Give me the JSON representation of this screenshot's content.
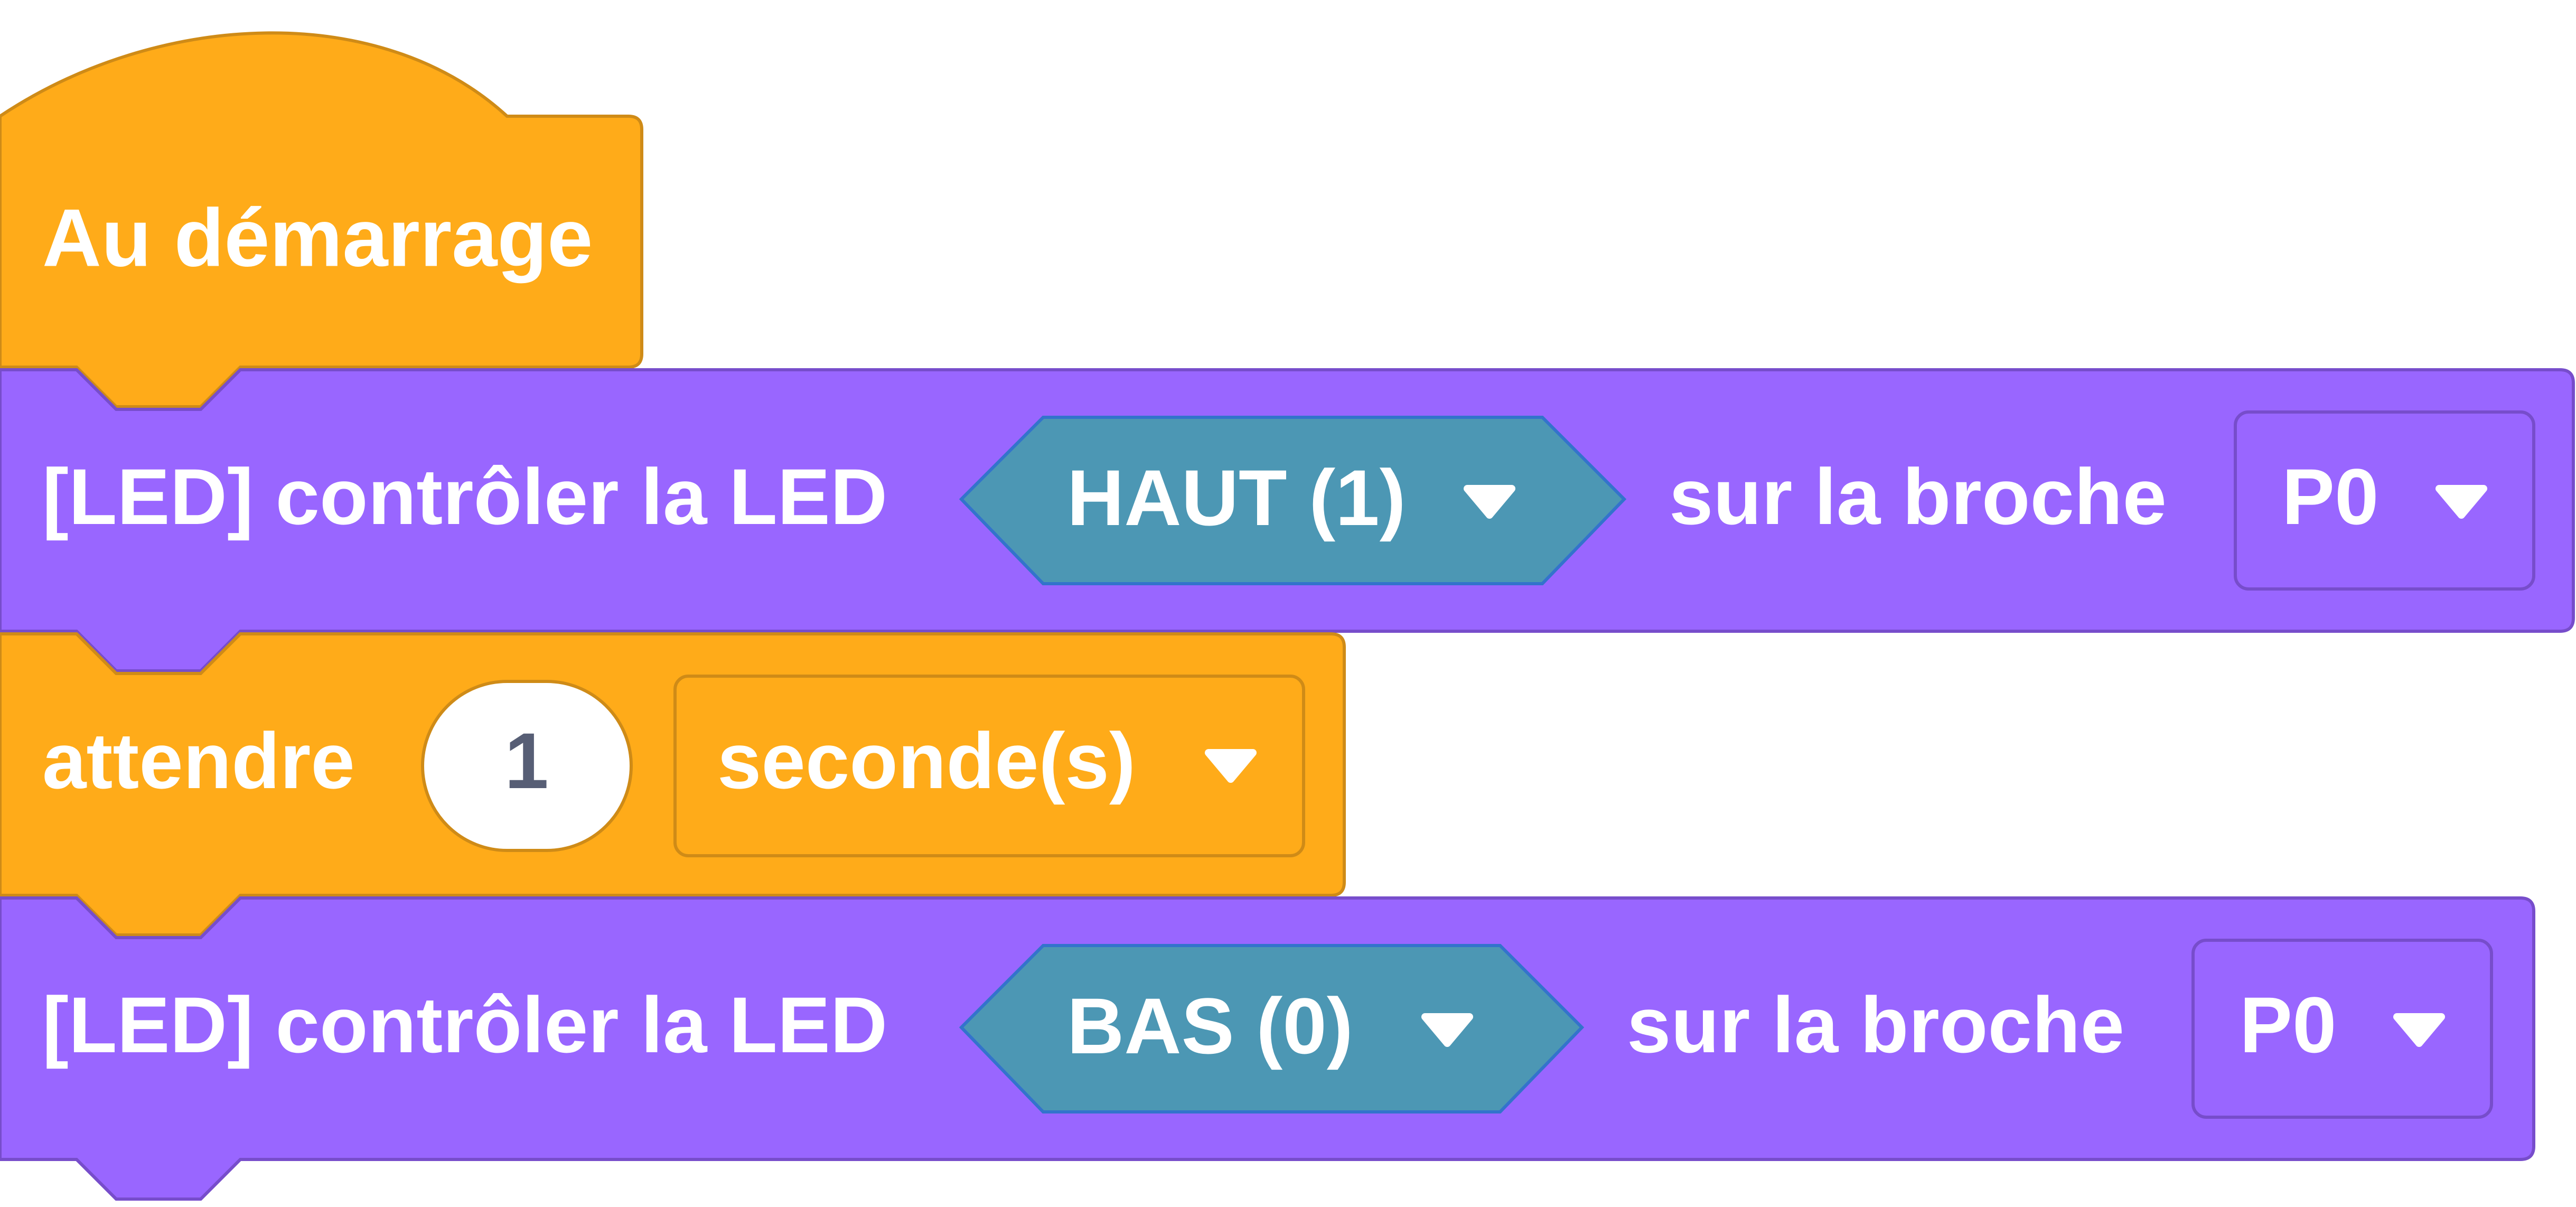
{
  "colors": {
    "events": "#FFAB19",
    "events_stroke": "#CF8B17",
    "led": "#9966FF",
    "led_stroke": "#774DCB",
    "menu": "#4C97B4",
    "menu_stroke": "#3373CC",
    "number_text": "#575E75",
    "white": "#FFFFFF"
  },
  "hat": {
    "label": "Au démarrage"
  },
  "blocks": [
    {
      "label": "[LED] contrôler la LED",
      "state": "HAUT (1)",
      "pin_label": "sur la broche",
      "pin": "P0"
    },
    {
      "label": "attendre",
      "value": "1",
      "unit": "seconde(s)"
    },
    {
      "label": "[LED] contrôler la LED",
      "state": "BAS (0)",
      "pin_label": "sur la broche",
      "pin": "P0"
    }
  ],
  "icons": {
    "dropdown": "chevron-down-icon"
  }
}
